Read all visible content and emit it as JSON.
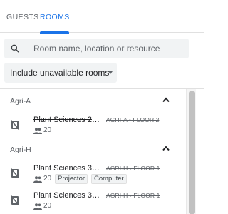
{
  "tabs": [
    {
      "label": "GUESTS",
      "active": false
    },
    {
      "label": "ROOMS",
      "active": true
    }
  ],
  "colors": {
    "accent": "#1a73e8",
    "chip_bg": "#f1f3f4",
    "muted_text": "#5f6368"
  },
  "search": {
    "placeholder": "Room name, location or resource",
    "icon": "search-icon"
  },
  "filter": {
    "selected": "Include unavailable rooms",
    "icon": "caret-down-icon"
  },
  "groups": [
    {
      "name": "Agri-A",
      "expanded": true,
      "rooms": [
        {
          "title": "Plant Sciences 22...",
          "location": "AGRI-A • FLOOR 2",
          "capacity": "20",
          "features": []
        }
      ]
    },
    {
      "name": "Agri-H",
      "expanded": true,
      "rooms": [
        {
          "title": "Plant Sciences 31...",
          "location": "AGRI-H • FLOOR 1",
          "capacity": "20",
          "features": [
            "Projector",
            "Computer"
          ]
        },
        {
          "title": "Plant Sciences 31...",
          "location": "AGRI-H • FLOOR 1",
          "capacity": "20",
          "features": []
        }
      ]
    }
  ]
}
